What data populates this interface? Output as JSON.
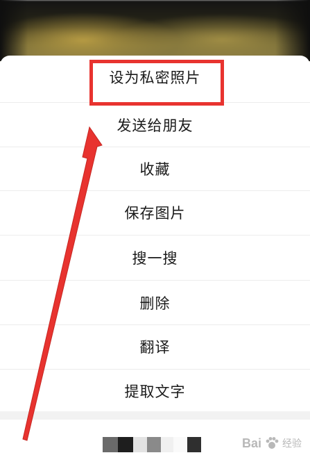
{
  "menu": {
    "items": [
      {
        "label": "设为私密照片"
      },
      {
        "label": "发送给朋友"
      },
      {
        "label": "收藏"
      },
      {
        "label": "保存图片"
      },
      {
        "label": "搜一搜"
      },
      {
        "label": "删除"
      },
      {
        "label": "翻译"
      },
      {
        "label": "提取文字"
      }
    ]
  },
  "annotation": {
    "highlight_color": "#e8332f",
    "arrow_color": "#e8332f"
  },
  "watermark": {
    "brand": "Bai",
    "suffix": "经验"
  }
}
